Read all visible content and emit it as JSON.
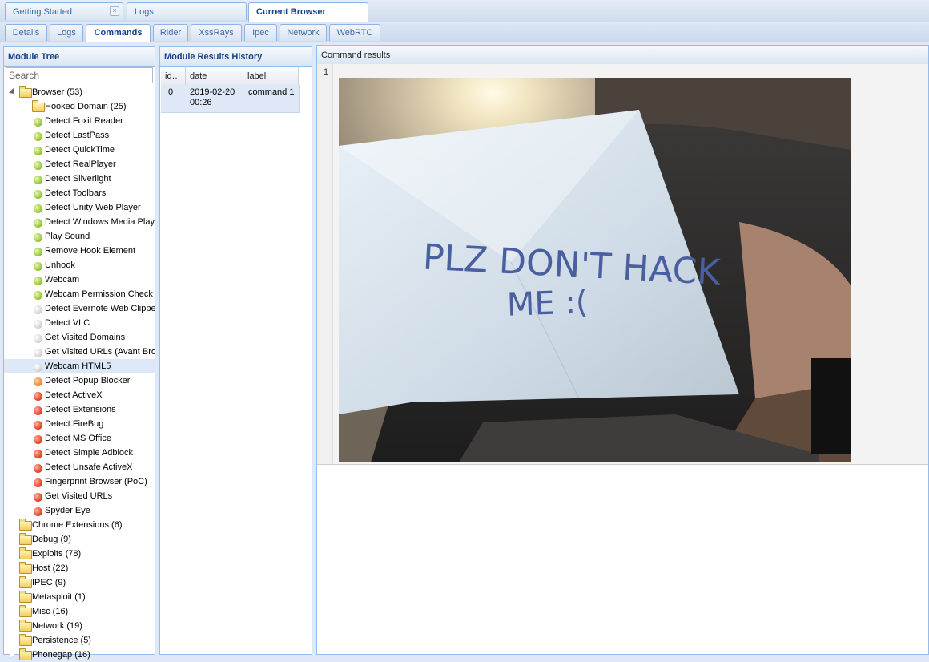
{
  "top_tabs": [
    {
      "label": "Getting Started",
      "closable": true
    },
    {
      "label": "Logs"
    },
    {
      "label": "Current Browser",
      "active": true
    }
  ],
  "sub_tabs": [
    {
      "label": "Details"
    },
    {
      "label": "Logs"
    },
    {
      "label": "Commands",
      "active": true
    },
    {
      "label": "Rider"
    },
    {
      "label": "XssRays"
    },
    {
      "label": "Ipec"
    },
    {
      "label": "Network"
    },
    {
      "label": "WebRTC"
    }
  ],
  "module_tree": {
    "title": "Module Tree",
    "search_placeholder": "Search",
    "items": [
      {
        "label": "Browser (53)",
        "type": "folder",
        "level": 0,
        "expanded": true
      },
      {
        "label": "Hooked Domain (25)",
        "type": "folder",
        "level": 1,
        "expanded": false
      },
      {
        "label": "Detect Foxit Reader",
        "status": "green",
        "level": 1
      },
      {
        "label": "Detect LastPass",
        "status": "green",
        "level": 1
      },
      {
        "label": "Detect QuickTime",
        "status": "green",
        "level": 1
      },
      {
        "label": "Detect RealPlayer",
        "status": "green",
        "level": 1
      },
      {
        "label": "Detect Silverlight",
        "status": "green",
        "level": 1
      },
      {
        "label": "Detect Toolbars",
        "status": "green",
        "level": 1
      },
      {
        "label": "Detect Unity Web Player",
        "status": "green",
        "level": 1
      },
      {
        "label": "Detect Windows Media Player",
        "status": "green",
        "level": 1
      },
      {
        "label": "Play Sound",
        "status": "green",
        "level": 1
      },
      {
        "label": "Remove Hook Element",
        "status": "green",
        "level": 1
      },
      {
        "label": "Unhook",
        "status": "green",
        "level": 1
      },
      {
        "label": "Webcam",
        "status": "green",
        "level": 1
      },
      {
        "label": "Webcam Permission Check",
        "status": "green",
        "level": 1
      },
      {
        "label": "Detect Evernote Web Clipper",
        "status": "grey",
        "level": 1
      },
      {
        "label": "Detect VLC",
        "status": "grey",
        "level": 1
      },
      {
        "label": "Get Visited Domains",
        "status": "grey",
        "level": 1
      },
      {
        "label": "Get Visited URLs (Avant Browser)",
        "status": "grey",
        "level": 1
      },
      {
        "label": "Webcam HTML5",
        "status": "grey",
        "level": 1,
        "selected": true
      },
      {
        "label": "Detect Popup Blocker",
        "status": "orange",
        "level": 1
      },
      {
        "label": "Detect ActiveX",
        "status": "red",
        "level": 1
      },
      {
        "label": "Detect Extensions",
        "status": "red",
        "level": 1
      },
      {
        "label": "Detect FireBug",
        "status": "red",
        "level": 1
      },
      {
        "label": "Detect MS Office",
        "status": "red",
        "level": 1
      },
      {
        "label": "Detect Simple Adblock",
        "status": "red",
        "level": 1
      },
      {
        "label": "Detect Unsafe ActiveX",
        "status": "red",
        "level": 1
      },
      {
        "label": "Fingerprint Browser (PoC)",
        "status": "red",
        "level": 1
      },
      {
        "label": "Get Visited URLs",
        "status": "red",
        "level": 1
      },
      {
        "label": "Spyder Eye",
        "status": "red",
        "level": 1
      },
      {
        "label": "Chrome Extensions (6)",
        "type": "folder",
        "level": 0,
        "expanded": false
      },
      {
        "label": "Debug (9)",
        "type": "folder",
        "level": 0,
        "expanded": false
      },
      {
        "label": "Exploits (78)",
        "type": "folder",
        "level": 0,
        "expanded": false
      },
      {
        "label": "Host (22)",
        "type": "folder",
        "level": 0,
        "expanded": false
      },
      {
        "label": "IPEC (9)",
        "type": "folder",
        "level": 0,
        "expanded": false
      },
      {
        "label": "Metasploit (1)",
        "type": "folder",
        "level": 0,
        "expanded": false
      },
      {
        "label": "Misc (16)",
        "type": "folder",
        "level": 0,
        "expanded": false
      },
      {
        "label": "Network (19)",
        "type": "folder",
        "level": 0,
        "expanded": false
      },
      {
        "label": "Persistence (5)",
        "type": "folder",
        "level": 0,
        "expanded": false
      },
      {
        "label": "Phonegap (16)",
        "type": "folder",
        "level": 0,
        "expanded": false
      }
    ]
  },
  "history": {
    "title": "Module Results History",
    "columns": [
      "id…",
      "date",
      "label"
    ],
    "rows": [
      {
        "id": "0",
        "date": "2019-02-20 00:26",
        "label": "command 1"
      }
    ]
  },
  "results": {
    "title": "Command results",
    "line_number": "1",
    "image_text": [
      "PLZ DON'T HACK",
      "ME :("
    ]
  },
  "colors": {
    "accent": "#15428b",
    "panel_border": "#99bbe8",
    "selected_row": "#dce8f8"
  }
}
